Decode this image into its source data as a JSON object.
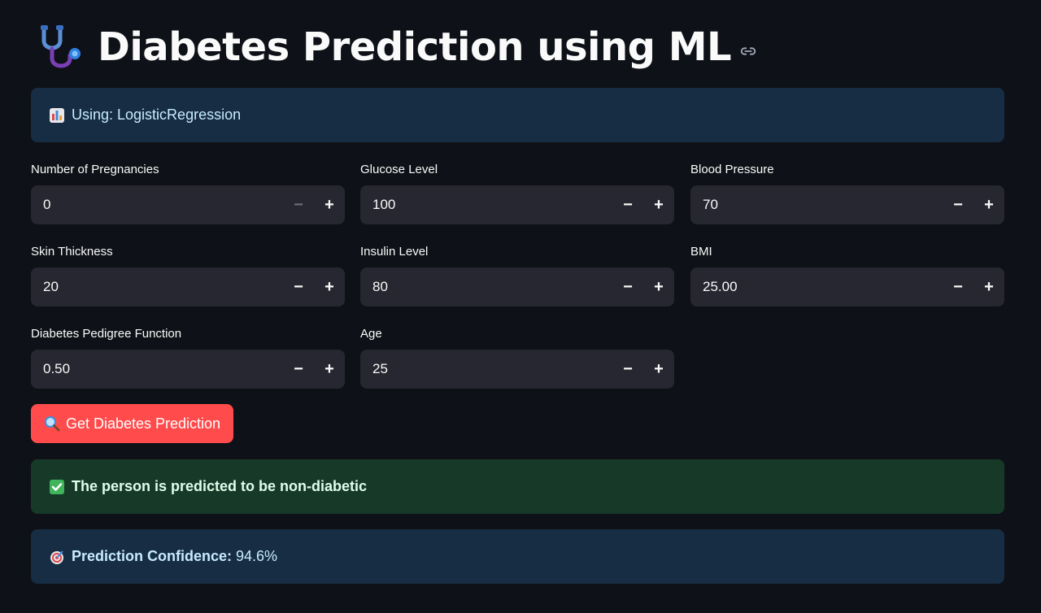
{
  "header": {
    "title": "Diabetes Prediction using ML",
    "icon": "stethoscope-icon",
    "link_icon": "link-icon"
  },
  "model_info": {
    "icon": "bar-chart-icon",
    "text": "Using: LogisticRegression"
  },
  "fields": [
    {
      "label": "Number of Pregnancies",
      "value": "0",
      "minus_disabled": true
    },
    {
      "label": "Glucose Level",
      "value": "100",
      "minus_disabled": false
    },
    {
      "label": "Blood Pressure",
      "value": "70",
      "minus_disabled": false
    },
    {
      "label": "Skin Thickness",
      "value": "20",
      "minus_disabled": false
    },
    {
      "label": "Insulin Level",
      "value": "80",
      "minus_disabled": false
    },
    {
      "label": "BMI",
      "value": "25.00",
      "minus_disabled": false
    },
    {
      "label": "Diabetes Pedigree Function",
      "value": "0.50",
      "minus_disabled": false
    },
    {
      "label": "Age",
      "value": "25",
      "minus_disabled": false
    }
  ],
  "stepper": {
    "minus": "−",
    "plus": "+"
  },
  "predict_button": {
    "icon": "magnifier-icon",
    "label": "Get Diabetes Prediction"
  },
  "result": {
    "icon": "check-mark-icon",
    "text": "The person is predicted to be non-diabetic"
  },
  "confidence": {
    "icon": "target-icon",
    "label": "Prediction Confidence:",
    "value": "94.6%"
  },
  "colors": {
    "background": "#0e1117",
    "accent": "#ff4b4b",
    "info_bg": "#172d43",
    "success_bg": "#173928",
    "input_bg": "#262730"
  }
}
